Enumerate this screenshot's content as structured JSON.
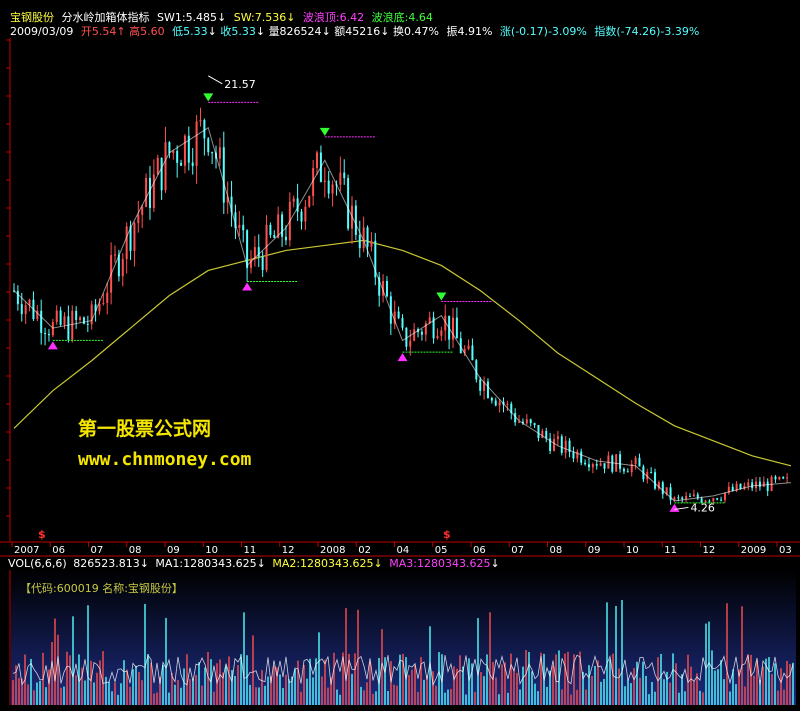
{
  "header": {
    "stock_name": "宝钢股份",
    "indicator_name": "分水岭加箱体指标",
    "sw1": "SW1:5.485",
    "sw1_arrow": "↓",
    "sw": "SW:7.536",
    "sw_arrow": "↓",
    "wave_top": "波浪顶:6.42",
    "wave_bottom": "波浪底:4.64"
  },
  "quote": {
    "date": "2009/03/09",
    "open": "开5.54",
    "open_arrow": "↑",
    "high": "高5.60",
    "low": "低5.33",
    "low_arrow": "↓",
    "close": "收5.33",
    "close_arrow": "↓",
    "volume": "量826524",
    "volume_arrow": "↓",
    "amount": "额45216",
    "amount_arrow": "↓",
    "turnover": "换0.47%",
    "amplitude": "振4.91%",
    "change": "涨(-0.17)-3.09%",
    "index": "指数(-74.26)-3.39%"
  },
  "volume_header": {
    "label": "VOL(6,6,6)",
    "vol": "826523.813",
    "vol_arrow": "↓",
    "ma1": "MA1:1280343.625",
    "ma1_arrow": "↓",
    "ma2": "MA2:1280343.625",
    "ma2_arrow": "↓",
    "ma3": "MA3:1280343.625",
    "ma3_arrow": "↓"
  },
  "code_line": "【代码:600019 名称:宝钢股份】",
  "watermark": {
    "title": "第一股票公式网",
    "url": "www.chnmoney.com"
  },
  "colors": {
    "up": "#ff5050",
    "down": "#54ffff",
    "ma_line": "#c8c832",
    "top_marker": "#30ff30",
    "bottom_marker": "#ff30ff",
    "axis": "#c00000",
    "volume_bg": "#1c2c80"
  },
  "chart_data": {
    "type": "line",
    "x_axis_labels": [
      "2007",
      "06",
      "07",
      "08",
      "09",
      "10",
      "11",
      "12",
      "2008",
      "02",
      "04",
      "05",
      "06",
      "07",
      "08",
      "09",
      "10",
      "11",
      "12",
      "2009",
      "03"
    ],
    "annotations": [
      {
        "text": "21.57",
        "label": "high"
      },
      {
        "text": "4.26",
        "label": "low"
      },
      {
        "text": "$",
        "label": "event"
      },
      {
        "text": "$",
        "label": "event"
      }
    ],
    "price_series": {
      "name": "close",
      "x_dates": [
        "2007-05",
        "2007-06",
        "2007-07",
        "2007-08",
        "2007-09",
        "2007-10",
        "2007-11",
        "2007-12",
        "2008-01",
        "2008-02",
        "2008-04",
        "2008-05",
        "2008-06",
        "2008-07",
        "2008-08",
        "2008-09",
        "2008-10",
        "2008-11",
        "2008-12",
        "2009-01",
        "2009-03"
      ],
      "values": [
        13.0,
        11.5,
        11.8,
        15.5,
        18.5,
        19.5,
        14.0,
        15.5,
        18.2,
        15.0,
        11.0,
        12.0,
        9.5,
        7.8,
        6.8,
        6.2,
        6.0,
        4.6,
        4.8,
        5.2,
        5.33
      ]
    },
    "ma_series": {
      "values": [
        7.5,
        9.0,
        10.2,
        11.5,
        12.8,
        13.8,
        14.2,
        14.6,
        14.8,
        15.0,
        14.6,
        14.0,
        13.0,
        11.8,
        10.5,
        9.5,
        8.5,
        7.6,
        7.0,
        6.4,
        6.0
      ]
    },
    "high_value": 21.57,
    "low_value": 4.26
  }
}
